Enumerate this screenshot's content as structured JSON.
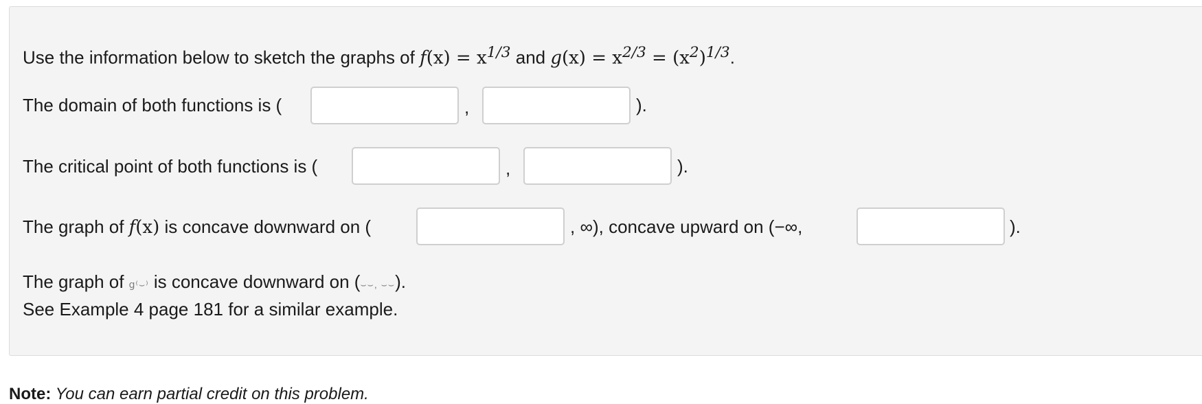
{
  "intro": {
    "prefix": "Use the information below to sketch the graphs of ",
    "f": "f",
    "fx": "(x)",
    "eq1": " = x",
    "exp1": "1/3",
    "and": " and ",
    "g": "g",
    "gx": "(x)",
    "eq2": " = x",
    "exp2": "2/3",
    "eq3": " = (x",
    "inner_exp": "2",
    "close": ")",
    "exp3": "1/3",
    "end": "."
  },
  "domain": {
    "label": "The domain of both functions is (",
    "comma": ",",
    "close": ").",
    "input1_value": "",
    "input2_value": ""
  },
  "critical": {
    "label": "The critical point of both functions is (",
    "comma": ",",
    "close": ").",
    "input1_value": "",
    "input2_value": ""
  },
  "concavity_f": {
    "label_prefix": "The graph of ",
    "f": "f",
    "fx": "(x)",
    "label_suffix": " is concave downward on (",
    "mid": ", ∞), concave upward on (−∞,",
    "close": ").",
    "input1_value": "",
    "input2_value": ""
  },
  "concavity_g": {
    "label_prefix": "The graph of ",
    "garbled_symbol": "ց⁽⌣⁾",
    "label_suffix": " is concave downward on (",
    "garbled_interval": "⌣⌣, ⌣⌣",
    "close": ")."
  },
  "see_example": "See Example 4 page 181 for a similar example.",
  "note": {
    "bold": "Note:",
    "text": " You can earn partial credit on this problem."
  }
}
